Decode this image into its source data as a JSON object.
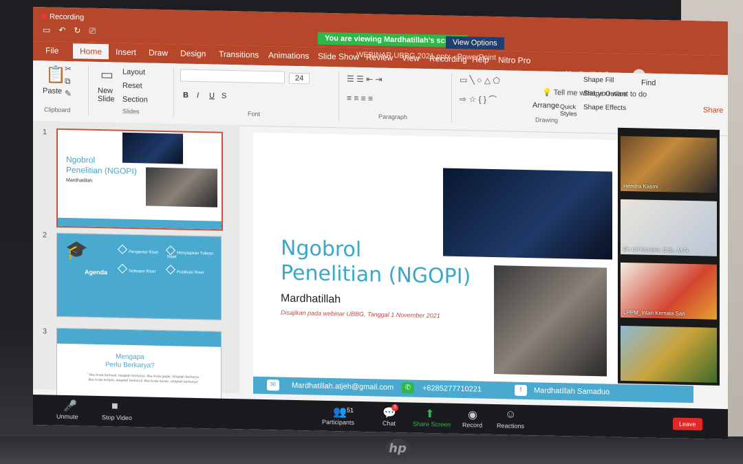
{
  "zoom": {
    "recording_label": "Recording",
    "share_notice": "You are viewing Mardhatillah's screen",
    "view_options": "View Options",
    "participant_count": "51",
    "chat_badge": "3",
    "toolbar": [
      "Unmute",
      "Stop Video",
      "Participants",
      "Chat",
      "Share Screen",
      "Record",
      "Reactions"
    ],
    "leave_label": "Leave",
    "videos": [
      {
        "name": "Hendra Kasmi"
      },
      {
        "name": "Dr. Lili Kasmini, S.Si., M.Si."
      },
      {
        "name": "LPPM_Intan Kemala Sari"
      },
      {
        "name": ""
      }
    ]
  },
  "powerpoint": {
    "file_title": "WEBINAR UBBG 2021.pptx - PowerPoint",
    "user_name": "Mardhatillah Bustaman",
    "user_initials": "MB",
    "tabs": [
      "File",
      "Home",
      "Insert",
      "Draw",
      "Design",
      "Transitions",
      "Animations",
      "Slide Show",
      "Review",
      "View",
      "Recording",
      "Help",
      "Nitro Pro"
    ],
    "tell_me": "Tell me what you want to do",
    "share": "Share",
    "ribbon": {
      "paste": "Paste",
      "new_slide": "New Slide",
      "layout": "Layout",
      "reset": "Reset",
      "section": "Section",
      "font_size": "24",
      "arrange": "Arrange",
      "quick_styles": "Quick Styles",
      "shape_fill": "Shape Fill",
      "shape_outline": "Shape Outline",
      "shape_effects": "Shape Effects",
      "find": "Find",
      "groups": [
        "Clipboard",
        "Slides",
        "Font",
        "Paragraph",
        "Drawing"
      ]
    }
  },
  "thumbnails": [
    {
      "num": "1",
      "title": "Ngobrol\nPenelitian (NGOPI)",
      "name": "Mardhatillah"
    },
    {
      "num": "2",
      "title": "Agenda",
      "items": [
        "Pengantar Riset",
        "Menyiapkan Tulisan Riset",
        "Software Riset",
        "Publikasi Riset"
      ]
    },
    {
      "num": "3",
      "title": "Mengapa\nPerlu Berkarya?",
      "text": "\"Jika Anda berhasil, tetaplah berkarya\nJika Anda gagal, tetaplah berkarya\nJika Anda tertarik, tetaplah berkarya\nJika Anda bosan, tetaplah berkarya\""
    }
  ],
  "slide": {
    "title_line1": "Ngobrol",
    "title_line2": "Penelitian (NGOPI)",
    "presenter": "Mardhatillah",
    "subtitle": "Disajikan pada webinar UBBG, Tanggal 1 November 2021",
    "email": "Mardhatillah.atjeh@gmail.com",
    "phone": "+6285277710221",
    "facebook": "Mardhatillah Samaduo"
  },
  "colors": {
    "accent": "#3aa7c7",
    "ppt_red": "#b7472a",
    "zoom_green": "#2fb84a",
    "leave_red": "#e02828"
  }
}
